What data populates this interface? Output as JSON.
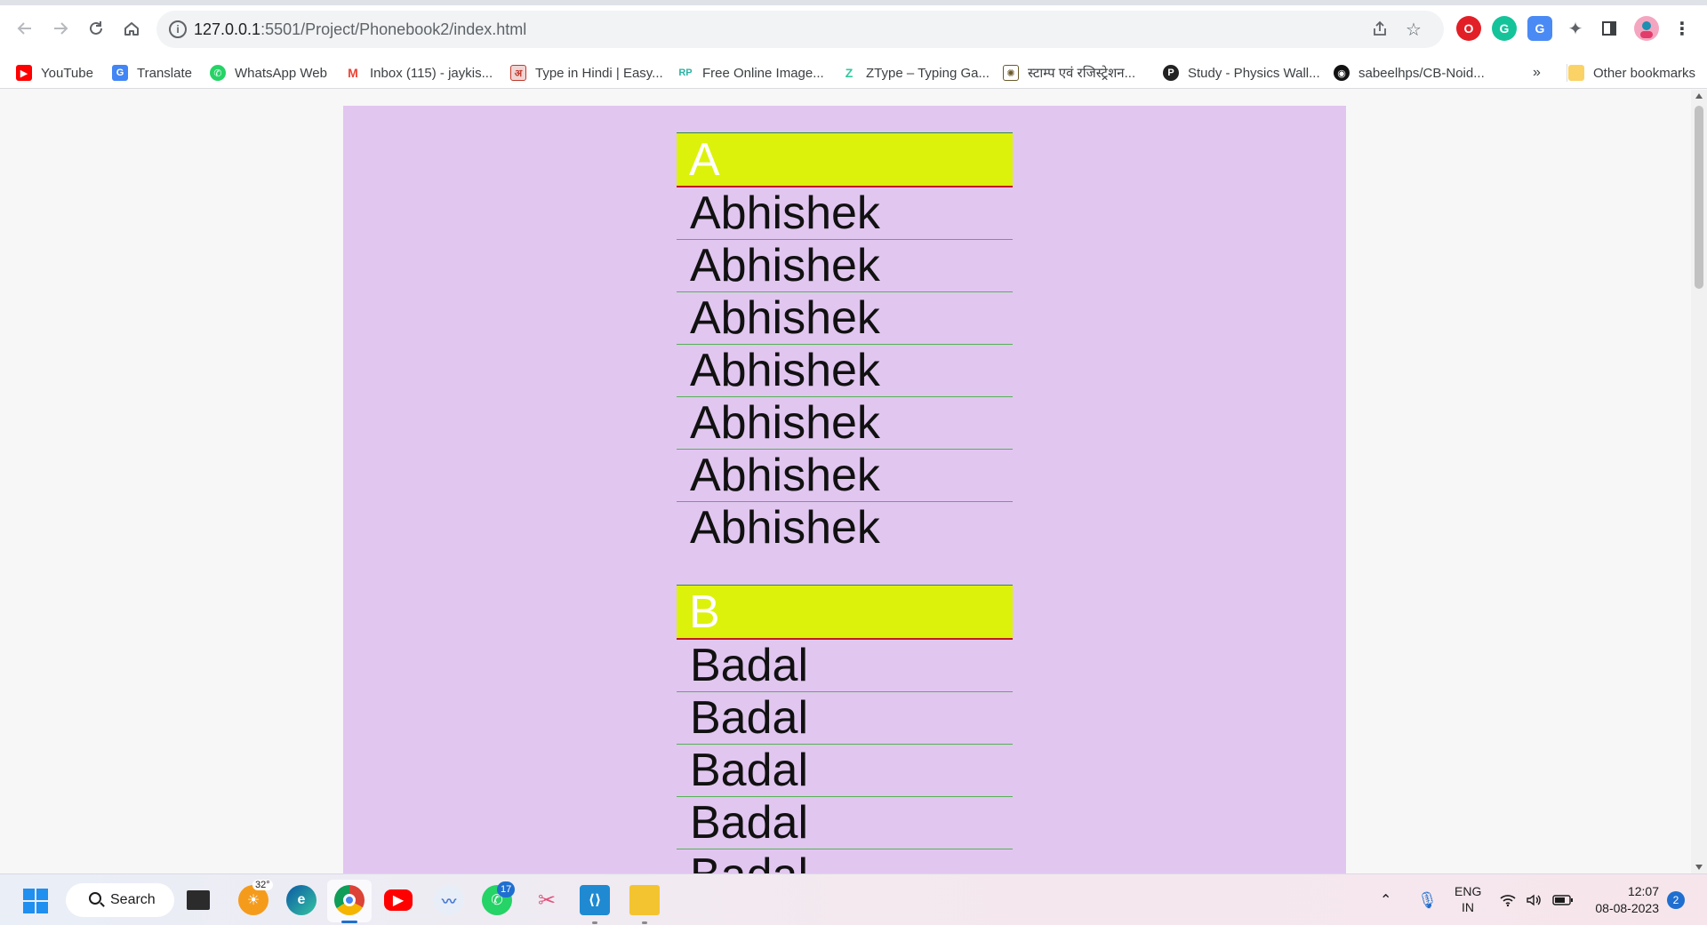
{
  "browser": {
    "url_host": "127.0.0.1",
    "url_rest": ":5501/Project/Phonebook2/index.html"
  },
  "bookmarks": [
    {
      "label": "YouTube",
      "icon": "youtube-icon",
      "color": "#ff0000"
    },
    {
      "label": "Translate",
      "icon": "google-translate-icon",
      "color": "#4285f4"
    },
    {
      "label": "WhatsApp Web",
      "icon": "whatsapp-icon",
      "color": "#25d366"
    },
    {
      "label": "Inbox (115) - jaykis...",
      "icon": "gmail-icon",
      "color": "#ea4335"
    },
    {
      "label": "Type in Hindi | Easy...",
      "icon": "hindi-type-icon",
      "color": "#c0392b"
    },
    {
      "label": "Free Online Image...",
      "icon": "image-tool-icon",
      "color": "#2bb3a3"
    },
    {
      "label": "ZType – Typing Ga...",
      "icon": "ztype-icon",
      "color": "#34c8a0"
    },
    {
      "label": "स्टाम्प एवं रजिस्ट्रेशन...",
      "icon": "emblem-icon",
      "color": "#6b5a2a"
    },
    {
      "label": "Study - Physics Wall...",
      "icon": "physics-wallah-icon",
      "color": "#222222"
    },
    {
      "label": "sabeelhps/CB-Noid...",
      "icon": "github-icon",
      "color": "#111111"
    }
  ],
  "bookmarks_overflow": "»",
  "other_bookmarks": "Other bookmarks",
  "phonebook": {
    "groups": [
      {
        "letter": "A",
        "contacts": [
          "Abhishek",
          "Abhishek",
          "Abhishek",
          "Abhishek",
          "Abhishek",
          "Abhishek",
          "Abhishek"
        ]
      },
      {
        "letter": "B",
        "contacts": [
          "Badal",
          "Badal",
          "Badal",
          "Badal",
          "Badal"
        ]
      }
    ],
    "colors": {
      "panel_background": "#e1c6f0",
      "letter_header": "#dcf20a",
      "letter_text": "#ffffff",
      "row_divider": "#55b255",
      "header_bottom_border": "#c01a1a"
    }
  },
  "taskbar": {
    "search_label": "Search",
    "weather_temp": "32°",
    "whatsapp_badge": "17",
    "language_line1": "ENG",
    "language_line2": "IN",
    "time": "12:07",
    "date": "08-08-2023",
    "notification_count": "2"
  }
}
